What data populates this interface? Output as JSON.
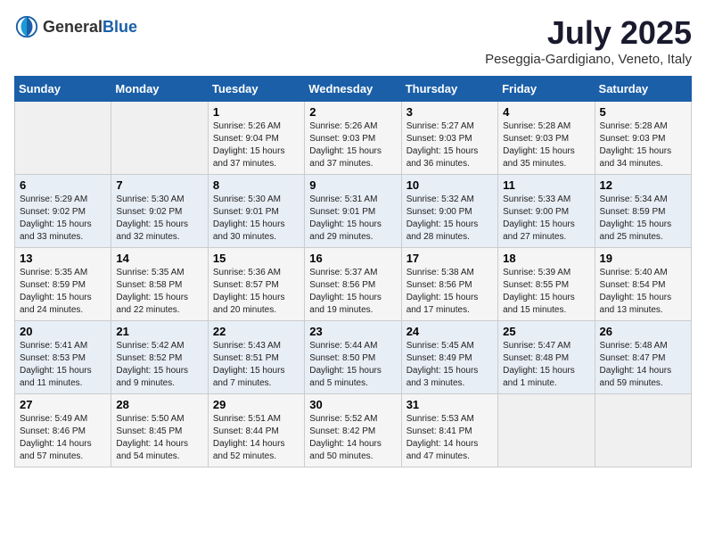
{
  "header": {
    "logo_general": "General",
    "logo_blue": "Blue",
    "month_year": "July 2025",
    "location": "Peseggia-Gardigiano, Veneto, Italy"
  },
  "weekdays": [
    "Sunday",
    "Monday",
    "Tuesday",
    "Wednesday",
    "Thursday",
    "Friday",
    "Saturday"
  ],
  "weeks": [
    [
      {
        "day": "",
        "sunrise": "",
        "sunset": "",
        "daylight": ""
      },
      {
        "day": "",
        "sunrise": "",
        "sunset": "",
        "daylight": ""
      },
      {
        "day": "1",
        "sunrise": "Sunrise: 5:26 AM",
        "sunset": "Sunset: 9:04 PM",
        "daylight": "Daylight: 15 hours and 37 minutes."
      },
      {
        "day": "2",
        "sunrise": "Sunrise: 5:26 AM",
        "sunset": "Sunset: 9:03 PM",
        "daylight": "Daylight: 15 hours and 37 minutes."
      },
      {
        "day": "3",
        "sunrise": "Sunrise: 5:27 AM",
        "sunset": "Sunset: 9:03 PM",
        "daylight": "Daylight: 15 hours and 36 minutes."
      },
      {
        "day": "4",
        "sunrise": "Sunrise: 5:28 AM",
        "sunset": "Sunset: 9:03 PM",
        "daylight": "Daylight: 15 hours and 35 minutes."
      },
      {
        "day": "5",
        "sunrise": "Sunrise: 5:28 AM",
        "sunset": "Sunset: 9:03 PM",
        "daylight": "Daylight: 15 hours and 34 minutes."
      }
    ],
    [
      {
        "day": "6",
        "sunrise": "Sunrise: 5:29 AM",
        "sunset": "Sunset: 9:02 PM",
        "daylight": "Daylight: 15 hours and 33 minutes."
      },
      {
        "day": "7",
        "sunrise": "Sunrise: 5:30 AM",
        "sunset": "Sunset: 9:02 PM",
        "daylight": "Daylight: 15 hours and 32 minutes."
      },
      {
        "day": "8",
        "sunrise": "Sunrise: 5:30 AM",
        "sunset": "Sunset: 9:01 PM",
        "daylight": "Daylight: 15 hours and 30 minutes."
      },
      {
        "day": "9",
        "sunrise": "Sunrise: 5:31 AM",
        "sunset": "Sunset: 9:01 PM",
        "daylight": "Daylight: 15 hours and 29 minutes."
      },
      {
        "day": "10",
        "sunrise": "Sunrise: 5:32 AM",
        "sunset": "Sunset: 9:00 PM",
        "daylight": "Daylight: 15 hours and 28 minutes."
      },
      {
        "day": "11",
        "sunrise": "Sunrise: 5:33 AM",
        "sunset": "Sunset: 9:00 PM",
        "daylight": "Daylight: 15 hours and 27 minutes."
      },
      {
        "day": "12",
        "sunrise": "Sunrise: 5:34 AM",
        "sunset": "Sunset: 8:59 PM",
        "daylight": "Daylight: 15 hours and 25 minutes."
      }
    ],
    [
      {
        "day": "13",
        "sunrise": "Sunrise: 5:35 AM",
        "sunset": "Sunset: 8:59 PM",
        "daylight": "Daylight: 15 hours and 24 minutes."
      },
      {
        "day": "14",
        "sunrise": "Sunrise: 5:35 AM",
        "sunset": "Sunset: 8:58 PM",
        "daylight": "Daylight: 15 hours and 22 minutes."
      },
      {
        "day": "15",
        "sunrise": "Sunrise: 5:36 AM",
        "sunset": "Sunset: 8:57 PM",
        "daylight": "Daylight: 15 hours and 20 minutes."
      },
      {
        "day": "16",
        "sunrise": "Sunrise: 5:37 AM",
        "sunset": "Sunset: 8:56 PM",
        "daylight": "Daylight: 15 hours and 19 minutes."
      },
      {
        "day": "17",
        "sunrise": "Sunrise: 5:38 AM",
        "sunset": "Sunset: 8:56 PM",
        "daylight": "Daylight: 15 hours and 17 minutes."
      },
      {
        "day": "18",
        "sunrise": "Sunrise: 5:39 AM",
        "sunset": "Sunset: 8:55 PM",
        "daylight": "Daylight: 15 hours and 15 minutes."
      },
      {
        "day": "19",
        "sunrise": "Sunrise: 5:40 AM",
        "sunset": "Sunset: 8:54 PM",
        "daylight": "Daylight: 15 hours and 13 minutes."
      }
    ],
    [
      {
        "day": "20",
        "sunrise": "Sunrise: 5:41 AM",
        "sunset": "Sunset: 8:53 PM",
        "daylight": "Daylight: 15 hours and 11 minutes."
      },
      {
        "day": "21",
        "sunrise": "Sunrise: 5:42 AM",
        "sunset": "Sunset: 8:52 PM",
        "daylight": "Daylight: 15 hours and 9 minutes."
      },
      {
        "day": "22",
        "sunrise": "Sunrise: 5:43 AM",
        "sunset": "Sunset: 8:51 PM",
        "daylight": "Daylight: 15 hours and 7 minutes."
      },
      {
        "day": "23",
        "sunrise": "Sunrise: 5:44 AM",
        "sunset": "Sunset: 8:50 PM",
        "daylight": "Daylight: 15 hours and 5 minutes."
      },
      {
        "day": "24",
        "sunrise": "Sunrise: 5:45 AM",
        "sunset": "Sunset: 8:49 PM",
        "daylight": "Daylight: 15 hours and 3 minutes."
      },
      {
        "day": "25",
        "sunrise": "Sunrise: 5:47 AM",
        "sunset": "Sunset: 8:48 PM",
        "daylight": "Daylight: 15 hours and 1 minute."
      },
      {
        "day": "26",
        "sunrise": "Sunrise: 5:48 AM",
        "sunset": "Sunset: 8:47 PM",
        "daylight": "Daylight: 14 hours and 59 minutes."
      }
    ],
    [
      {
        "day": "27",
        "sunrise": "Sunrise: 5:49 AM",
        "sunset": "Sunset: 8:46 PM",
        "daylight": "Daylight: 14 hours and 57 minutes."
      },
      {
        "day": "28",
        "sunrise": "Sunrise: 5:50 AM",
        "sunset": "Sunset: 8:45 PM",
        "daylight": "Daylight: 14 hours and 54 minutes."
      },
      {
        "day": "29",
        "sunrise": "Sunrise: 5:51 AM",
        "sunset": "Sunset: 8:44 PM",
        "daylight": "Daylight: 14 hours and 52 minutes."
      },
      {
        "day": "30",
        "sunrise": "Sunrise: 5:52 AM",
        "sunset": "Sunset: 8:42 PM",
        "daylight": "Daylight: 14 hours and 50 minutes."
      },
      {
        "day": "31",
        "sunrise": "Sunrise: 5:53 AM",
        "sunset": "Sunset: 8:41 PM",
        "daylight": "Daylight: 14 hours and 47 minutes."
      },
      {
        "day": "",
        "sunrise": "",
        "sunset": "",
        "daylight": ""
      },
      {
        "day": "",
        "sunrise": "",
        "sunset": "",
        "daylight": ""
      }
    ]
  ]
}
